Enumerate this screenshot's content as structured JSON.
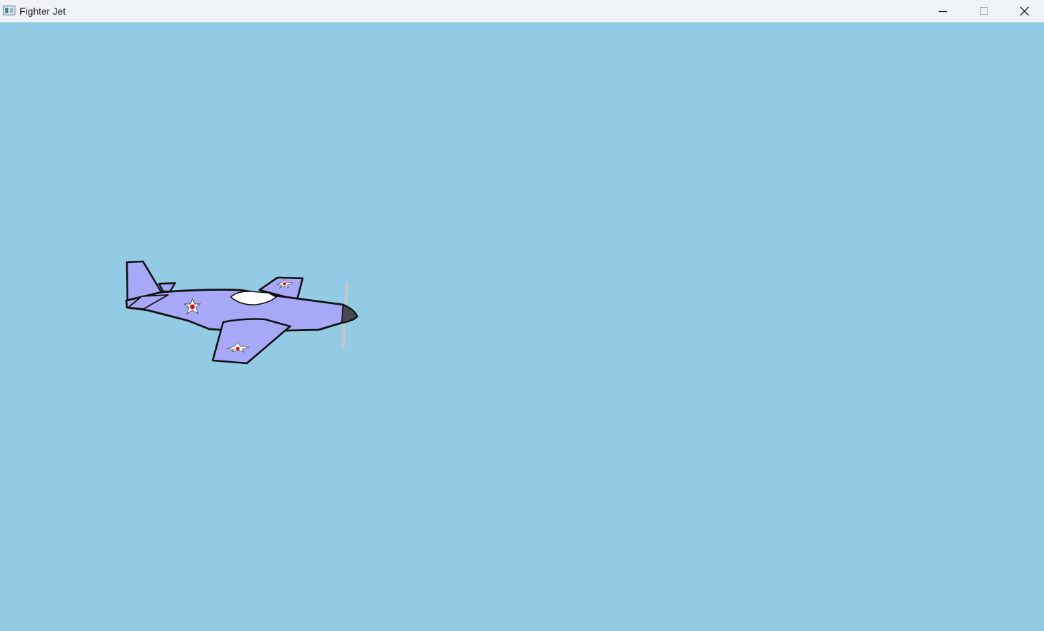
{
  "window": {
    "title": "Fighter Jet",
    "icon": "app-window-icon"
  },
  "titlebar_controls": {
    "minimize_icon": "minimize-icon",
    "maximize_icon": "maximize-icon",
    "close_icon": "close-icon"
  },
  "scene": {
    "sky_color": "#93cbe4",
    "player": {
      "sprite": "fighter-plane",
      "body_color": "#a8a8f8",
      "outline_color": "#111111",
      "canopy_color": "#ffffff",
      "nose_color": "#4a4a55",
      "roundel_color": "#d01010"
    }
  }
}
